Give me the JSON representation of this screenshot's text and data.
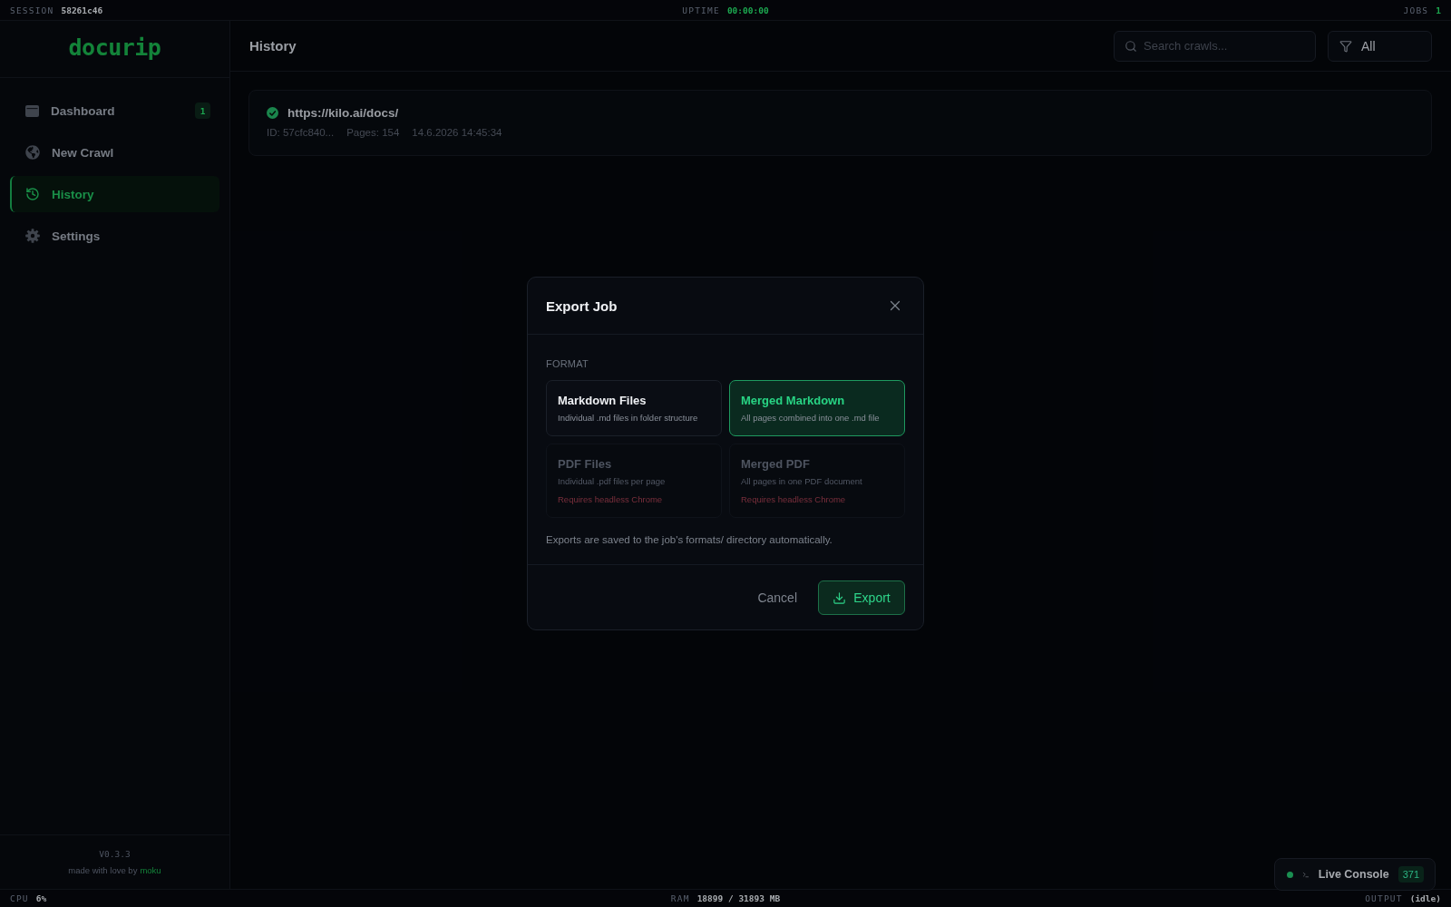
{
  "top_bar": {
    "session_label": "SESSION",
    "session_id": "58261c46",
    "uptime_label": "UPTIME",
    "uptime": "00:00:00",
    "jobs_label": "JOBS",
    "jobs": "1"
  },
  "sidebar": {
    "logo": "docurip",
    "items": [
      {
        "label": "Dashboard",
        "badge": "1",
        "selected": false
      },
      {
        "label": "New Crawl",
        "selected": false
      },
      {
        "label": "History",
        "selected": true
      },
      {
        "label": "Settings",
        "selected": false
      }
    ],
    "version": "V0.3.3",
    "credit": {
      "text": "made with love by",
      "link": "moku"
    }
  },
  "main": {
    "title": "History",
    "search": {
      "placeholder": "Search crawls..."
    },
    "filter": {
      "value": "All"
    },
    "jobs": [
      {
        "completed": true,
        "url": "https://kilo.ai/docs/",
        "id": "ID: 57cfc840...",
        "pages": "Pages: 154",
        "date": "14.6.2026 14:45:34"
      }
    ]
  },
  "modal": {
    "title": "Export Job",
    "section_label": "FORMAT",
    "formats": [
      {
        "title": "Markdown Files",
        "description": "Individual .md files in folder structure",
        "selected": false,
        "disabled": false
      },
      {
        "title": "Merged Markdown",
        "description": "All pages combined into one .md file",
        "selected": true,
        "disabled": false
      },
      {
        "title": "PDF Files",
        "description": "Individual .pdf files per page",
        "warning": "Requires headless Chrome",
        "selected": false,
        "disabled": true
      },
      {
        "title": "Merged PDF",
        "description": "All pages in one PDF document",
        "warning": "Requires headless Chrome",
        "selected": false,
        "disabled": true
      }
    ],
    "note": "Exports are saved to the job's formats/ directory automatically.",
    "cancel": "Cancel",
    "confirm": "Export"
  },
  "live_console": {
    "connected": true,
    "label": "Live Console",
    "count": "371"
  },
  "status_bar": {
    "cpu_label": "CPU",
    "cpu": "6%",
    "ram_label": "RAM",
    "ram": "18899 / 31893 MB",
    "output_label": "OUTPUT",
    "output": "(idle)"
  }
}
